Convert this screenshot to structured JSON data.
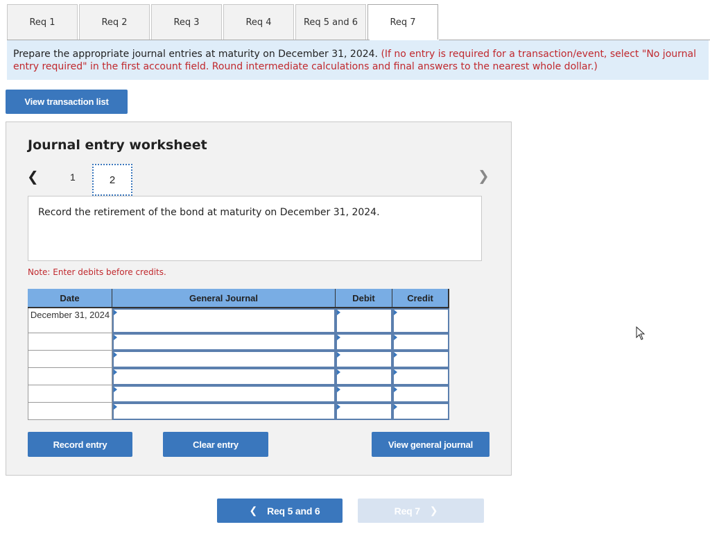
{
  "tabs": [
    {
      "label": "Req 1",
      "active": false
    },
    {
      "label": "Req 2",
      "active": false
    },
    {
      "label": "Req 3",
      "active": false
    },
    {
      "label": "Req 4",
      "active": false
    },
    {
      "label": "Req 5 and 6",
      "active": false
    },
    {
      "label": "Req 7",
      "active": true
    }
  ],
  "instructions": {
    "main": "Prepare the appropriate journal entries at maturity on December 31, 2024.",
    "note": "(If no entry is required for a transaction/event, select \"No journal entry required\" in the first account field. Round intermediate calculations and final answers to the nearest whole dollar.)"
  },
  "view_transaction_list_label": "View transaction list",
  "worksheet": {
    "title": "Journal entry worksheet",
    "prev_icon": "chevron-left",
    "next_icon": "chevron-right",
    "pages": [
      "1",
      "2"
    ],
    "current_page": "2",
    "description": "Record the retirement of the bond at maturity on December 31, 2024.",
    "note": "Note: Enter debits before credits.",
    "table": {
      "headers": {
        "date": "Date",
        "account": "General Journal",
        "debit": "Debit",
        "credit": "Credit"
      },
      "rows": [
        {
          "date": "December 31, 2024",
          "account": "",
          "debit": "",
          "credit": ""
        },
        {
          "date": "",
          "account": "",
          "debit": "",
          "credit": ""
        },
        {
          "date": "",
          "account": "",
          "debit": "",
          "credit": ""
        },
        {
          "date": "",
          "account": "",
          "debit": "",
          "credit": ""
        },
        {
          "date": "",
          "account": "",
          "debit": "",
          "credit": ""
        },
        {
          "date": "",
          "account": "",
          "debit": "",
          "credit": ""
        }
      ]
    },
    "buttons": {
      "record": "Record entry",
      "clear": "Clear entry",
      "view_journal": "View general journal"
    }
  },
  "footer_nav": {
    "prev_label": "Req 5 and 6",
    "next_label": "Req 7",
    "next_disabled": true
  },
  "colors": {
    "primary_button": "#3a77bd",
    "table_header": "#79ade4",
    "banner_bg": "#dfedf9",
    "instruction_red": "#c0282d",
    "disabled_button": "#d8e3f1"
  }
}
